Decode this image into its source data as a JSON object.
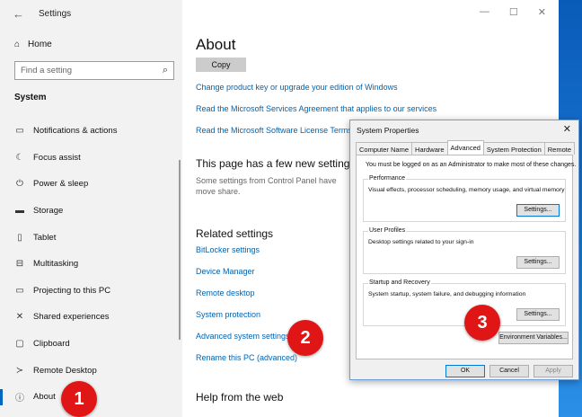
{
  "settings": {
    "window_title": "Settings",
    "home_label": "Home",
    "search_placeholder": "Find a setting",
    "section": "System",
    "nav": [
      {
        "icon": "▭",
        "label": "Notifications & actions"
      },
      {
        "icon": "☾",
        "label": "Focus assist"
      },
      {
        "icon": "⏻",
        "label": "Power & sleep"
      },
      {
        "icon": "▬",
        "label": "Storage"
      },
      {
        "icon": "▯",
        "label": "Tablet"
      },
      {
        "icon": "⊟",
        "label": "Multitasking"
      },
      {
        "icon": "▭",
        "label": "Projecting to this PC"
      },
      {
        "icon": "✕",
        "label": "Shared experiences"
      },
      {
        "icon": "▢",
        "label": "Clipboard"
      },
      {
        "icon": "≻",
        "label": "Remote Desktop"
      },
      {
        "icon": "ⓘ",
        "label": "About"
      }
    ],
    "active_nav": "About"
  },
  "main": {
    "title": "About",
    "copy_label": "Copy",
    "links_top": [
      "Change product key or upgrade your edition of Windows",
      "Read the Microsoft Services Agreement that applies to our services",
      "Read the Microsoft Software License Terms"
    ],
    "new_settings_heading": "This page has a few new setting",
    "new_settings_text": "Some settings from Control Panel have move share.",
    "related_heading": "Related settings",
    "related_links": [
      "BitLocker settings",
      "Device Manager",
      "Remote desktop",
      "System protection",
      "Advanced system settings",
      "Rename this PC (advanced)"
    ],
    "help_heading": "Help from the web"
  },
  "dialog": {
    "title": "System Properties",
    "tabs": [
      "Computer Name",
      "Hardware",
      "Advanced",
      "System Protection",
      "Remote"
    ],
    "active_tab": "Advanced",
    "note": "You must be logged on as an Administrator to make most of these changes.",
    "performance": {
      "title": "Performance",
      "desc": "Visual effects, processor scheduling, memory usage, and virtual memory",
      "button": "Settings..."
    },
    "user_profiles": {
      "title": "User Profiles",
      "desc": "Desktop settings related to your sign-in",
      "button": "Settings..."
    },
    "startup": {
      "title": "Startup and Recovery",
      "desc": "System startup, system failure, and debugging information",
      "button": "Settings..."
    },
    "env_button": "Environment Variables...",
    "ok": "OK",
    "cancel": "Cancel",
    "apply": "Apply"
  },
  "badges": [
    "1",
    "2",
    "3"
  ],
  "colors": {
    "badge": "#e01616",
    "link": "#0063b1",
    "accent": "#0067c0"
  }
}
